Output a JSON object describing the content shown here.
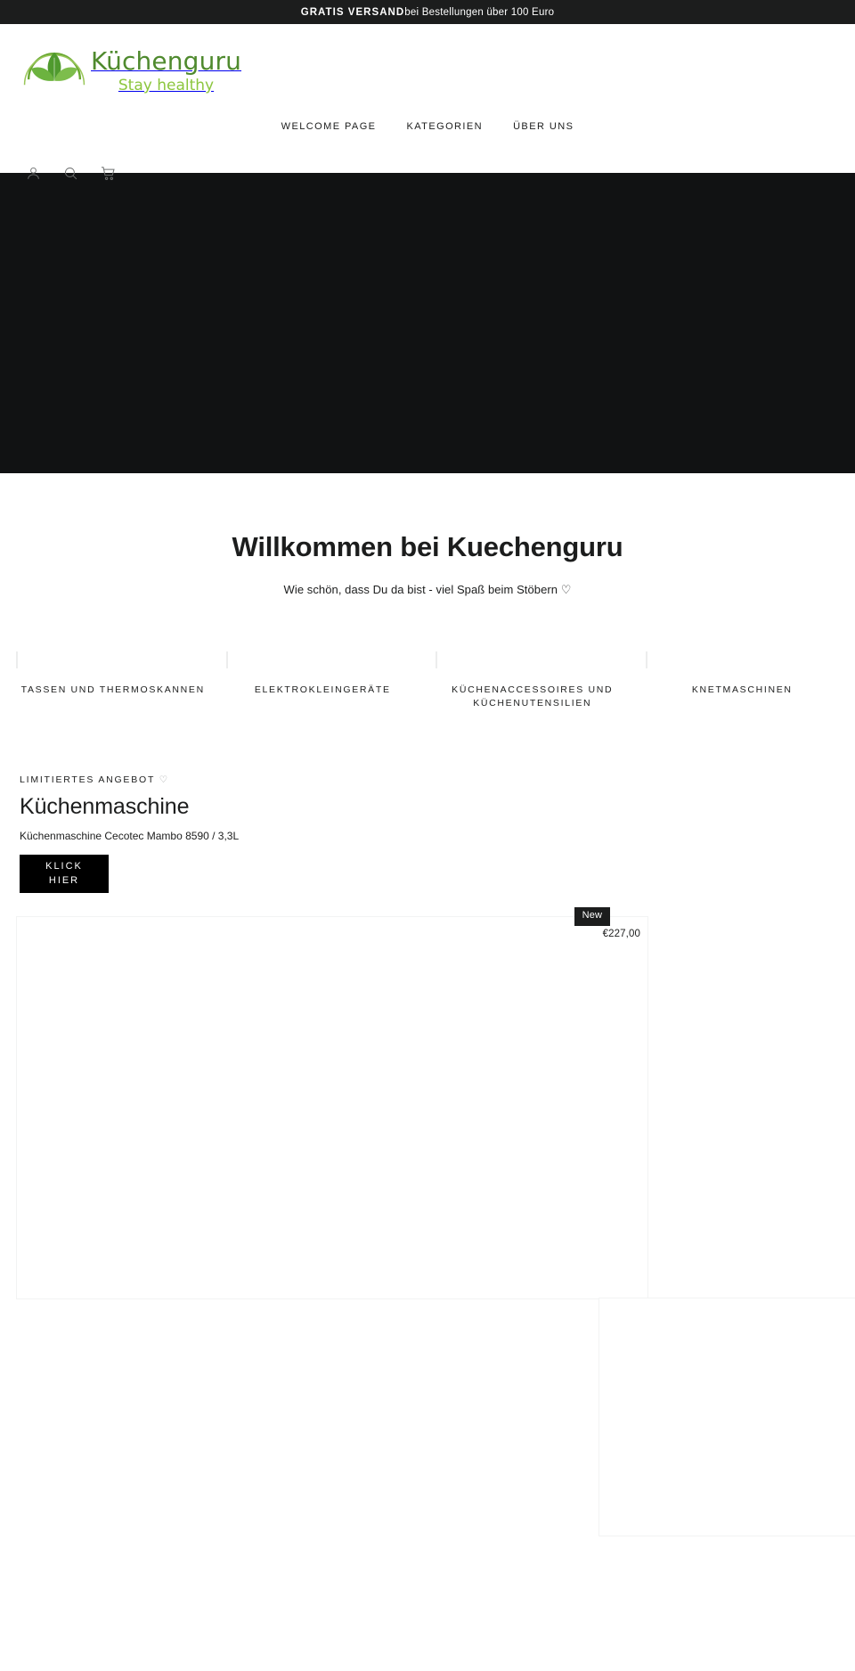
{
  "announcement": {
    "bold": "GRATIS VERSAND",
    "rest": " bei Bestellungen über 100 Euro"
  },
  "header": {
    "logo": {
      "title": "Küchenguru",
      "tagline": "Stay healthy",
      "brand_dark_green": "#4f8a2e",
      "brand_light_green": "#8cc63e"
    },
    "nav": [
      {
        "label": "WELCOME PAGE",
        "name": "nav-welcome-page"
      },
      {
        "label": "KATEGORIEN",
        "name": "nav-kategorien"
      },
      {
        "label": "ÜBER UNS",
        "name": "nav-ueber-uns"
      }
    ],
    "icons": [
      {
        "name": "account-icon",
        "title": "Account"
      },
      {
        "name": "search-icon",
        "title": "Search"
      },
      {
        "name": "cart-icon",
        "title": "Cart"
      }
    ]
  },
  "hero": {
    "background_color": "#111213"
  },
  "welcome": {
    "heading": "Willkommen bei Kuechenguru",
    "subheading": "Wie schön, dass Du da bist - viel Spaß beim Stöbern ♡"
  },
  "categories": [
    {
      "label": "TASSEN UND THERMOSKANNEN"
    },
    {
      "label": "ELEKTROKLEINGERÄTE"
    },
    {
      "label": "KÜCHENACCESSOIRES UND KÜCHENUTENSILIEN"
    },
    {
      "label": "KNETMASCHINEN"
    }
  ],
  "offer": {
    "eyebrow": "LIMITIERTES ANGEBOT",
    "eyebrow_heart": "♡",
    "title": "Küchenmaschine",
    "description": "Küchenmaschine Cecotec Mambo 8590 / 3,3L",
    "cta_line1": "KLICK",
    "cta_line2": "HIER"
  },
  "products": [
    {
      "badge": "New",
      "price": "€227,00"
    },
    {
      "badge": "",
      "price": ""
    }
  ]
}
